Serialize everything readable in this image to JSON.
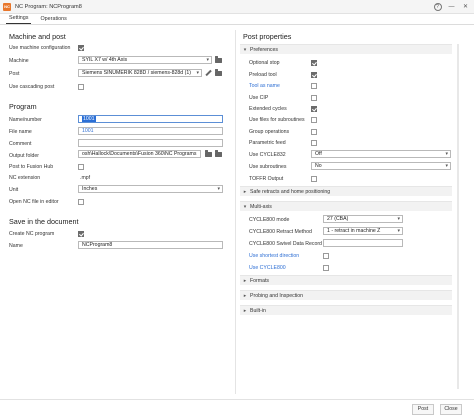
{
  "window": {
    "title": "NC Program: NCProgram8",
    "help_label": "?",
    "minimize_glyph": "—",
    "close_glyph": "✕"
  },
  "tabs": [
    "Settings",
    "Operations"
  ],
  "machine_and_post": {
    "heading": "Machine and post",
    "use_machine_config": {
      "label": "Use machine configuration",
      "checked": true
    },
    "machine": {
      "label": "Machine",
      "value": "SYIL X7 w/ 4th Axis"
    },
    "post": {
      "label": "Post",
      "value": "Siemens SINUMERIK 828D / siemens-828d (1)"
    },
    "use_cascading_post": {
      "label": "Use cascading post",
      "checked": false
    }
  },
  "program": {
    "heading": "Program",
    "name_number": {
      "label": "Name/number",
      "value": "1001"
    },
    "file_name": {
      "label": "File name",
      "value": "1001"
    },
    "comment": {
      "label": "Comment",
      "value": ""
    },
    "output_folder": {
      "label": "Output folder",
      "value": "osh\\Hallock\\Documents\\Fusion 360\\NC Programs"
    },
    "post_to_fusion_hub": {
      "label": "Post to Fusion Hub",
      "checked": false
    },
    "nc_extension": {
      "label": "NC extension",
      "value": ".mpf"
    },
    "unit": {
      "label": "Unit",
      "value": "Inches"
    },
    "open_nc_in_editor": {
      "label": "Open NC file in editor",
      "checked": false
    }
  },
  "save_in_document": {
    "heading": "Save in the document",
    "create_nc_program": {
      "label": "Create NC program",
      "checked": true
    },
    "name": {
      "label": "Name",
      "value": "NCProgram8"
    }
  },
  "post_properties": {
    "heading": "Post properties",
    "groups": {
      "preferences": "Preferences",
      "safe_retracts": "Safe retracts and home positioning",
      "multi_axis": "Multi-axis",
      "formats": "Formats",
      "probing": "Probing and Inspection",
      "built_in": "Built-in"
    },
    "preferences": [
      {
        "label": "Optional stop",
        "checked": true
      },
      {
        "label": "Preload tool",
        "checked": true
      },
      {
        "label": "Tool as name",
        "checked": false,
        "link": true
      },
      {
        "label": "Use CIP",
        "checked": false
      },
      {
        "label": "Extended cycles",
        "checked": true
      },
      {
        "label": "Use files for subroutines",
        "checked": false
      },
      {
        "label": "Group operations",
        "checked": false
      },
      {
        "label": "Parametric feed",
        "checked": false
      }
    ],
    "use_cycle832": {
      "label": "Use CYCLE832",
      "value": "Off"
    },
    "use_subroutines": {
      "label": "Use subroutines",
      "value": "No"
    },
    "toffr_output": {
      "label": "TOFFR Output",
      "checked": false
    },
    "multi_axis": {
      "cycle800_mode": {
        "label": "CYCLE800 mode",
        "value": "27 (CBA)"
      },
      "cycle800_retract": {
        "label": "CYCLE800 Retract Method",
        "value": "1 - retract in machine Z"
      },
      "cycle800_swivel": {
        "label": "CYCLE800 Swivel Data Record",
        "value": ""
      },
      "use_shortest_direction": {
        "label": "Use shortest direction",
        "checked": false
      },
      "use_cycle800": {
        "label": "Use CYCLE800",
        "checked": false
      }
    }
  },
  "footer": {
    "post_label": "Post",
    "close_label": "Close"
  },
  "colors": {
    "accent": "#2b6fd6",
    "link": "#2e6fd4",
    "app_icon": "#e8762b"
  }
}
